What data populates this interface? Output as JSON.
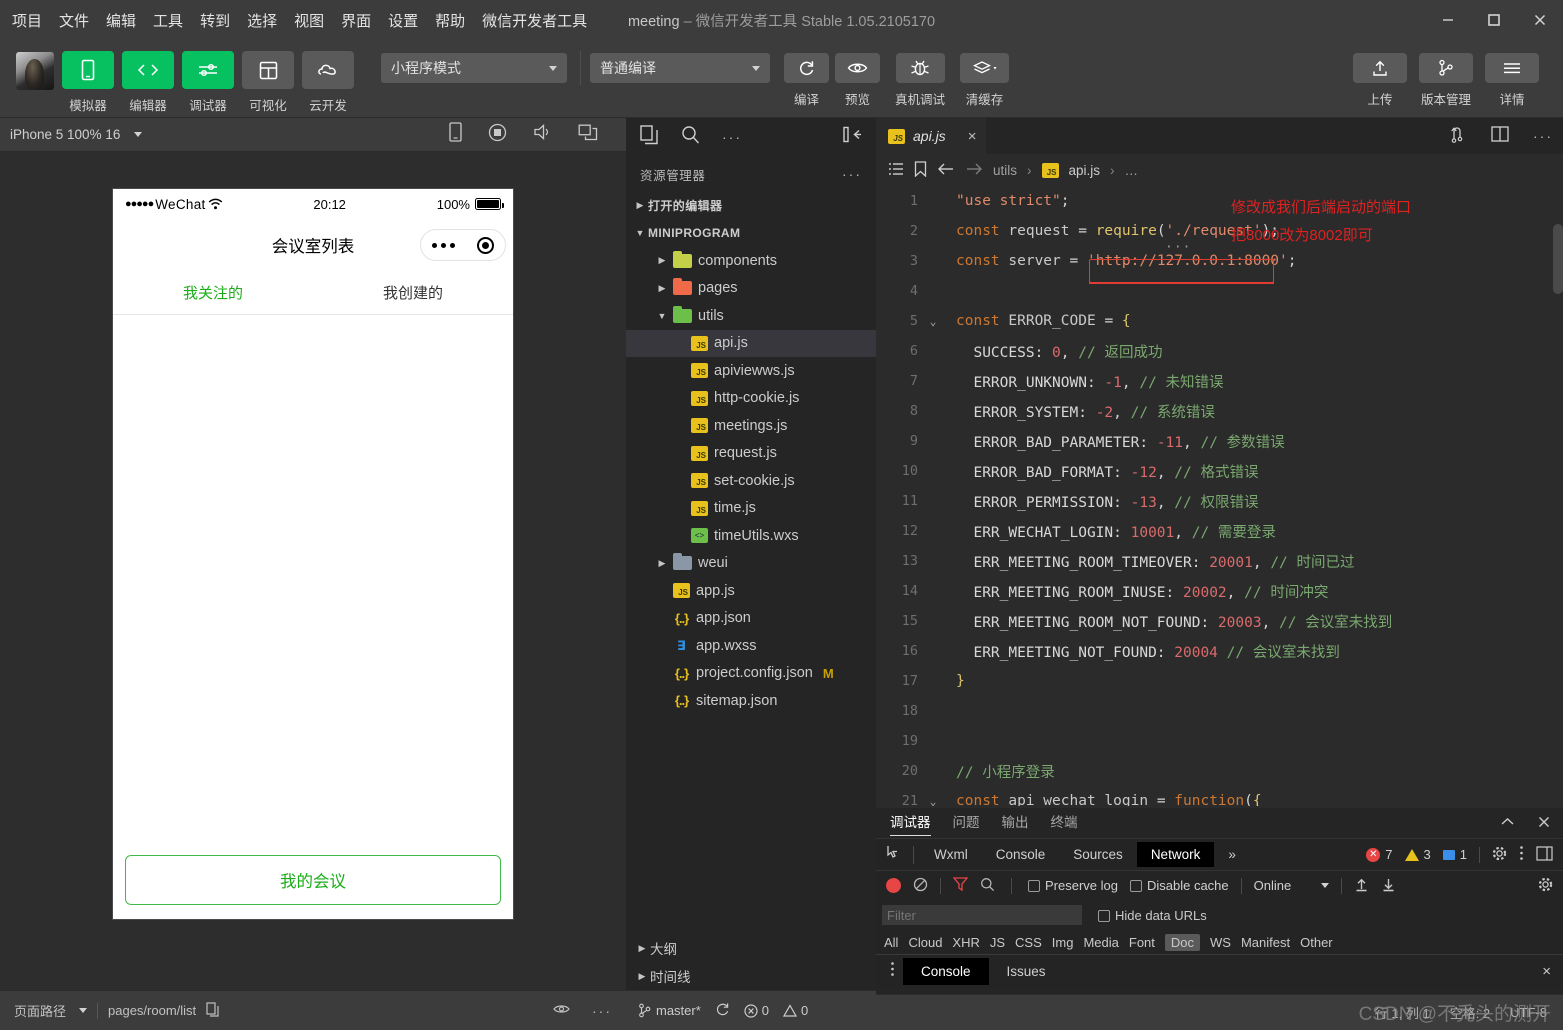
{
  "window": {
    "title_project": "meeting",
    "title_rest": "– 微信开发者工具 Stable 1.05.2105170",
    "minimize": "minimize-icon",
    "maximize": "maximize-icon",
    "close": "close-icon"
  },
  "menubar": {
    "items": [
      "项目",
      "文件",
      "编辑",
      "工具",
      "转到",
      "选择",
      "视图",
      "界面",
      "设置",
      "帮助",
      "微信开发者工具"
    ]
  },
  "toolbar": {
    "buttons": [
      {
        "label": "模拟器",
        "icon": "phone-icon",
        "active": true
      },
      {
        "label": "编辑器",
        "icon": "code-icon",
        "active": true
      },
      {
        "label": "调试器",
        "icon": "debug-sliders-icon",
        "active": true
      },
      {
        "label": "可视化",
        "icon": "layout-icon",
        "active": false
      },
      {
        "label": "云开发",
        "icon": "cloud-icon",
        "active": false
      }
    ],
    "mode_select": "小程序模式",
    "compile_select": "普通编译",
    "actions": [
      {
        "label": "编译",
        "icon": "refresh-icon"
      },
      {
        "label": "预览",
        "icon": "eye-icon"
      },
      {
        "label": "真机调试",
        "icon": "bug-icon"
      },
      {
        "label": "清缓存",
        "icon": "layers-icon"
      }
    ],
    "right_actions": [
      {
        "label": "上传",
        "icon": "upload-icon"
      },
      {
        "label": "版本管理",
        "icon": "git-branch-icon"
      },
      {
        "label": "详情",
        "icon": "hamburger-icon"
      }
    ]
  },
  "simulator": {
    "device": "iPhone 5 100% 16",
    "header_icons": [
      "device-rotate-icon",
      "record-icon",
      "volume-icon",
      "windows-icon"
    ],
    "status_bar": {
      "carrier": "WeChat",
      "signal_dots": "●●●●●",
      "wifi": "wifi-icon",
      "time": "20:12",
      "battery_pct": "100%"
    },
    "nav_title": "会议室列表",
    "tabs": [
      {
        "label": "我关注的",
        "active": true
      },
      {
        "label": "我创建的",
        "active": false
      }
    ],
    "footer_button": "我的会议",
    "status": {
      "page_path_label": "页面路径",
      "page_path": "pages/room/list",
      "copy_icon": "copy-icon",
      "eye_icon": "eye-icon",
      "more_icon": "more-icon"
    }
  },
  "explorer": {
    "activity_icons": [
      "files-icon",
      "search-icon",
      "more-icon",
      "collapse-sidebar-icon"
    ],
    "title": "资源管理器",
    "more": "···",
    "open_editors": "打开的编辑器",
    "project_name": "MINIPROGRAM",
    "tree": [
      {
        "name": "components",
        "type": "folder",
        "depth": 1,
        "expanded": false,
        "color": "#c4d148"
      },
      {
        "name": "pages",
        "type": "folder",
        "depth": 1,
        "expanded": false,
        "color": "#f06a4a"
      },
      {
        "name": "utils",
        "type": "folder",
        "depth": 1,
        "expanded": true,
        "color": "#6cc04a"
      },
      {
        "name": "api.js",
        "type": "js",
        "depth": 2,
        "selected": true
      },
      {
        "name": "apiviewws.js",
        "type": "js",
        "depth": 2
      },
      {
        "name": "http-cookie.js",
        "type": "js",
        "depth": 2
      },
      {
        "name": "meetings.js",
        "type": "js",
        "depth": 2
      },
      {
        "name": "request.js",
        "type": "js",
        "depth": 2
      },
      {
        "name": "set-cookie.js",
        "type": "js",
        "depth": 2
      },
      {
        "name": "time.js",
        "type": "js",
        "depth": 2
      },
      {
        "name": "timeUtils.wxs",
        "type": "wxs",
        "depth": 2
      },
      {
        "name": "weui",
        "type": "folder",
        "depth": 1,
        "expanded": false,
        "color": "#8a97a6"
      },
      {
        "name": "app.js",
        "type": "js",
        "depth": 1
      },
      {
        "name": "app.json",
        "type": "json",
        "depth": 1
      },
      {
        "name": "app.wxss",
        "type": "wxss",
        "depth": 1
      },
      {
        "name": "project.config.json",
        "type": "json",
        "depth": 1,
        "badge": "M"
      },
      {
        "name": "sitemap.json",
        "type": "json",
        "depth": 1
      }
    ],
    "bottom_sections": [
      "大纲",
      "时间线"
    ],
    "status": {
      "branch": "master*",
      "sync_icon": "sync-icon",
      "errors": "0",
      "warnings": "0"
    }
  },
  "editor": {
    "tab": {
      "name": "api.js",
      "icon": "js-icon",
      "close": "×"
    },
    "tab_actions": [
      "split-editor-icon",
      "split-pane-icon",
      "more-icon"
    ],
    "breadcrumb_icons": [
      "outline-icon",
      "bookmark-icon",
      "back-arrow-icon",
      "forward-arrow-icon"
    ],
    "breadcrumb": [
      "utils",
      "api.js",
      "…"
    ],
    "annotation": [
      "修改成我们后端启动的端口",
      "把8000改为8002即可"
    ],
    "lines": [
      {
        "n": "1",
        "fold": "",
        "html": "<span class=\"str\">\"use strict\"</span><span class=\"punct\">;</span>"
      },
      {
        "n": "2",
        "fold": "",
        "html": "<span class=\"kw\">const</span> <span class=\"var\">request</span> <span class=\"punct\">=</span> <span class=\"fn\">require</span><span class=\"punct\">(</span><span class=\"str\">'./request'</span><span class=\"punct\">);</span>"
      },
      {
        "n": "3",
        "fold": "",
        "html": "<span class=\"kw\">const</span> <span class=\"var\">server</span> <span class=\"punct\">=</span> <span class=\"str\">'http://127.0.0.1:8000'</span><span class=\"punct\">;</span>"
      },
      {
        "n": "4",
        "fold": "",
        "html": ""
      },
      {
        "n": "5",
        "fold": "v",
        "html": "<span class=\"kw\">const</span> <span class=\"var\">ERROR_CODE</span> <span class=\"punct\">=</span> <span class=\"fn\">{</span>"
      },
      {
        "n": "6",
        "fold": "",
        "html": "  <span class=\"prop\">SUCCESS:</span> <span class=\"num\">0</span><span class=\"punct\">,</span> <span class=\"cmt\">// 返回成功</span>"
      },
      {
        "n": "7",
        "fold": "",
        "html": "  <span class=\"prop\">ERROR_UNKNOWN:</span> <span class=\"num\">-1</span><span class=\"punct\">,</span> <span class=\"cmt\">// 未知错误</span>"
      },
      {
        "n": "8",
        "fold": "",
        "html": "  <span class=\"prop\">ERROR_SYSTEM:</span> <span class=\"num\">-2</span><span class=\"punct\">,</span> <span class=\"cmt\">// 系统错误</span>"
      },
      {
        "n": "9",
        "fold": "",
        "html": "  <span class=\"prop\">ERROR_BAD_PARAMETER:</span> <span class=\"num\">-11</span><span class=\"punct\">,</span> <span class=\"cmt\">// 参数错误</span>"
      },
      {
        "n": "10",
        "fold": "",
        "html": "  <span class=\"prop\">ERROR_BAD_FORMAT:</span> <span class=\"num\">-12</span><span class=\"punct\">,</span> <span class=\"cmt\">// 格式错误</span>"
      },
      {
        "n": "11",
        "fold": "",
        "html": "  <span class=\"prop\">ERROR_PERMISSION:</span> <span class=\"num\">-13</span><span class=\"punct\">,</span> <span class=\"cmt\">// 权限错误</span>"
      },
      {
        "n": "12",
        "fold": "",
        "html": "  <span class=\"prop\">ERR_WECHAT_LOGIN:</span> <span class=\"num\">10001</span><span class=\"punct\">,</span> <span class=\"cmt\">// 需要登录</span>"
      },
      {
        "n": "13",
        "fold": "",
        "html": "  <span class=\"prop\">ERR_MEETING_ROOM_TIMEOVER:</span> <span class=\"num\">20001</span><span class=\"punct\">,</span> <span class=\"cmt\">// 时间已过</span>"
      },
      {
        "n": "14",
        "fold": "",
        "html": "  <span class=\"prop\">ERR_MEETING_ROOM_INUSE:</span> <span class=\"num\">20002</span><span class=\"punct\">,</span> <span class=\"cmt\">// 时间冲突</span>"
      },
      {
        "n": "15",
        "fold": "",
        "html": "  <span class=\"prop\">ERR_MEETING_ROOM_NOT_FOUND:</span> <span class=\"num\">20003</span><span class=\"punct\">,</span> <span class=\"cmt\">// 会议室未找到</span>"
      },
      {
        "n": "16",
        "fold": "",
        "html": "  <span class=\"prop\">ERR_MEETING_NOT_FOUND:</span> <span class=\"num\">20004</span> <span class=\"cmt\">// 会议室未找到</span>"
      },
      {
        "n": "17",
        "fold": "",
        "html": "<span class=\"fn\">}</span>"
      },
      {
        "n": "18",
        "fold": "",
        "html": ""
      },
      {
        "n": "19",
        "fold": "",
        "html": ""
      },
      {
        "n": "20",
        "fold": "",
        "html": "<span class=\"cmt\">// 小程序登录</span>"
      },
      {
        "n": "21",
        "fold": "v",
        "html": "<span class=\"kw\">const</span> <span class=\"var\">api_wechat_login</span> <span class=\"punct\">=</span> <span class=\"kw\">function</span><span class=\"punct\">(</span><span class=\"fn\">{</span>"
      }
    ]
  },
  "devtools": {
    "panel_tabs": [
      {
        "label": "调试器",
        "active": true
      },
      {
        "label": "问题",
        "active": false
      },
      {
        "label": "输出",
        "active": false
      },
      {
        "label": "终端",
        "active": false
      }
    ],
    "panel_actions": [
      "chevron-up-icon",
      "close-icon"
    ],
    "inspect_icon": "inspect-element-icon",
    "cdp_tabs": [
      {
        "label": "Wxml",
        "active": false
      },
      {
        "label": "Console",
        "active": false
      },
      {
        "label": "Sources",
        "active": false
      },
      {
        "label": "Network",
        "active": true
      }
    ],
    "overflow": "»",
    "counts": {
      "errors": "7",
      "warnings": "3",
      "info": "1"
    },
    "cdp_right_icons": [
      "gear-icon",
      "kebab-menu-icon",
      "dock-icon"
    ],
    "network_toolbar": {
      "record_icon": "record-icon",
      "clear_icon": "clear-icon",
      "filter_icon": "filter-icon",
      "search_icon": "search-icon",
      "preserve_log": "Preserve log",
      "disable_cache": "Disable cache",
      "throttling": "Online",
      "import_icon": "upload-icon",
      "export_icon": "download-icon",
      "settings_icon": "gear-icon"
    },
    "filter": {
      "placeholder": "Filter",
      "value": "",
      "hide_data_urls": "Hide data URLs"
    },
    "resource_types": [
      "All",
      "Cloud",
      "XHR",
      "JS",
      "CSS",
      "Img",
      "Media",
      "Font",
      "Doc",
      "WS",
      "Manifest",
      "Other"
    ],
    "selected_resource_type": "Doc",
    "drawer_tabs": [
      {
        "label": "Console",
        "active": true
      },
      {
        "label": "Issues",
        "active": false
      }
    ],
    "drawer_close": "×",
    "status": {
      "cursor": "行 1, 列 1",
      "indent": "空格: 2",
      "encoding": "UTF-8"
    }
  },
  "watermark": "CSDN @不秃头的测开"
}
